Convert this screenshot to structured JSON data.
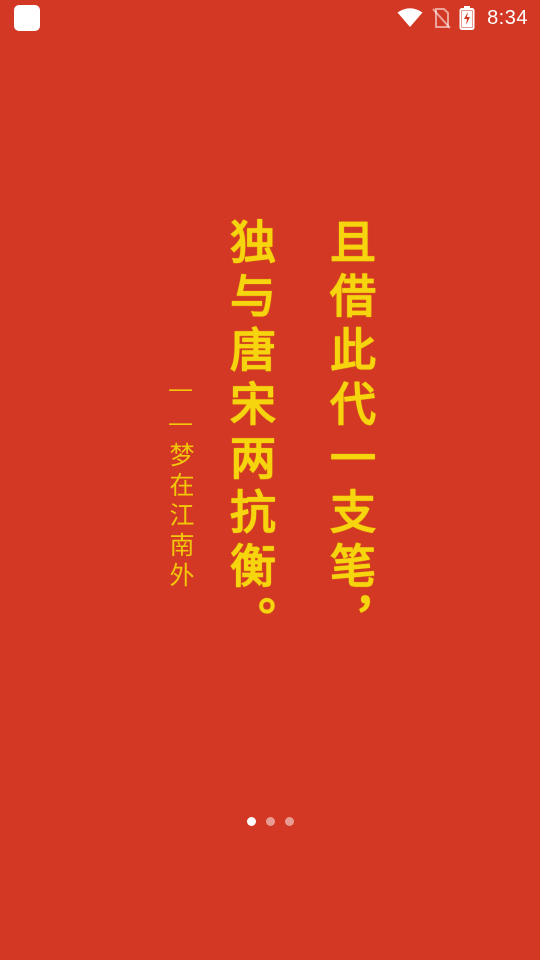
{
  "status_bar": {
    "time": "8:34",
    "icons": [
      "app-notification-icon",
      "wifi-icon",
      "no-sim-icon",
      "battery-charging-icon"
    ]
  },
  "poem": {
    "line1": "且借此代一支笔，",
    "line2": "独与唐宋两抗衡。",
    "author": "——梦在江南外"
  },
  "pager": {
    "page_count": 3,
    "active_index": 0
  },
  "colors": {
    "background": "#d23823",
    "poem_text": "#f6d50f",
    "dot_active": "#ffffff",
    "dot_inactive": "rgba(255,255,255,0.5)"
  }
}
